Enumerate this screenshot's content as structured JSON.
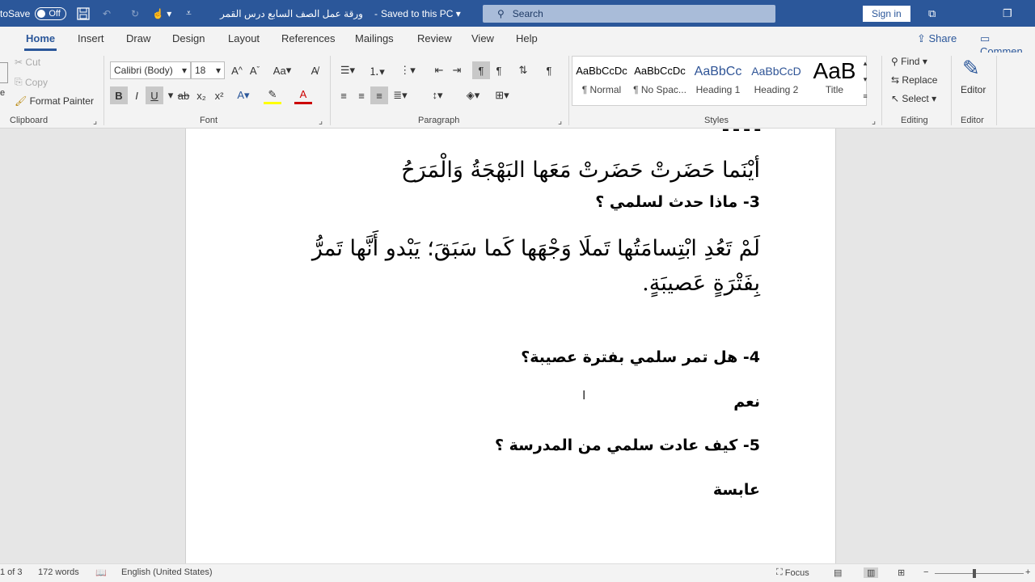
{
  "titlebar": {
    "autosave_label": "toSave",
    "autosave_state": "Off",
    "doc_title": "ورقة عمل الصف السابع درس  القمر",
    "saved_status": "Saved to this PC",
    "search_placeholder": "Search",
    "signin_label": "Sign in"
  },
  "tabs": [
    "Home",
    "Insert",
    "Draw",
    "Design",
    "Layout",
    "References",
    "Mailings",
    "Review",
    "View",
    "Help"
  ],
  "share": {
    "share_label": "Share",
    "comments_label": "Commen"
  },
  "clipboard": {
    "cut": "Cut",
    "copy": "Copy",
    "format_painter": "Format Painter",
    "group": "Clipboard"
  },
  "font": {
    "name": "Calibri (Body)",
    "size": "18",
    "aa": "Aa",
    "bold": "B",
    "italic": "I",
    "underline": "U",
    "strike": "ab",
    "sub": "x₂",
    "sup": "x²",
    "group": "Font"
  },
  "paragraph": {
    "group": "Paragraph",
    "pilcrow": "¶"
  },
  "styles": {
    "group": "Styles",
    "items": [
      {
        "preview": "AaBbCcDc",
        "name": "¶ Normal"
      },
      {
        "preview": "AaBbCcDc",
        "name": "¶ No Spac..."
      },
      {
        "preview": "AaBbCc",
        "name": "Heading 1"
      },
      {
        "preview": "AaBbCcD",
        "name": "Heading 2"
      },
      {
        "preview": "AaB",
        "name": "Title"
      }
    ]
  },
  "editing": {
    "find": "Find",
    "replace": "Replace",
    "select": "Select",
    "group": "Editing"
  },
  "editor": {
    "label": "Editor",
    "group": "Editor"
  },
  "document": {
    "line1": "أيْنَما حَضَرتْ حَضَرتْ مَعَها البَهْجَةُ وَالْمَرَحُ",
    "q3": "3- ماذا حدث لسلمي ؟",
    "line2a": "لَمْ تَعُدِ ابْتِسامَتُها تَملَا وَجْهَها كَما سَبَقَ؛ يَبْدو أَنَّها تَمرُّ",
    "line2b": "بِفَتْرَةٍ عَصيبَةٍ.",
    "q4": "4- هل تمر سلمي بفترة عصيبة؟",
    "a4": "نعم",
    "q5": "5- كيف عادت سلمي من المدرسة ؟",
    "a5": "عابسة"
  },
  "status": {
    "page": "1 of 3",
    "words": "172 words",
    "language": "English (United States)",
    "focus": "Focus"
  },
  "colors": {
    "word_blue": "#2b579a",
    "ribbon_bg": "#f3f3f3"
  }
}
